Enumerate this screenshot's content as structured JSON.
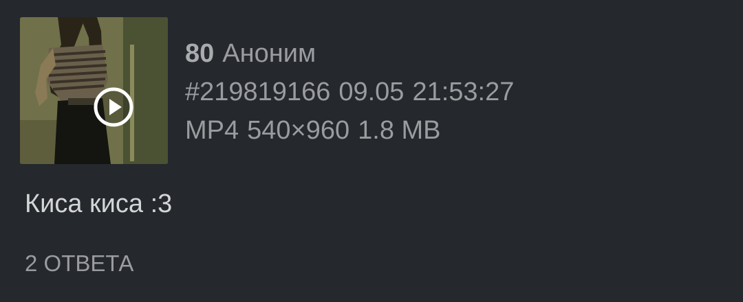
{
  "post": {
    "number": "80",
    "author": "Аноним",
    "post_id": "#219819166",
    "date": "09.05",
    "time": "21:53:27",
    "file": {
      "format": "MP4",
      "resolution": "540×960",
      "size": "1.8 MB"
    },
    "comment": "Киса киса :3",
    "replies_label": "2 ОТВЕТА",
    "thumbnail_icon": "play-icon"
  },
  "colors": {
    "background": "#25282c",
    "meta_text": "#9a9c9f",
    "comment_text": "#d4d5d7"
  }
}
